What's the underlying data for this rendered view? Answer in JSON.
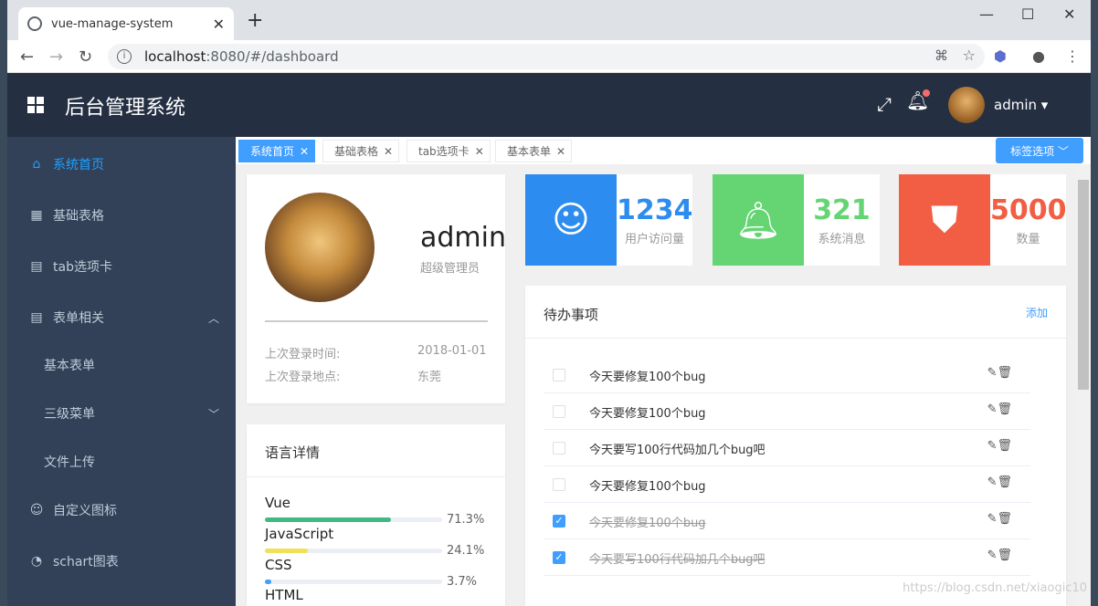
{
  "browser": {
    "tab_title": "vue-manage-system",
    "url_host": "localhost",
    "url_path": ":8080/#/dashboard"
  },
  "app": {
    "title": "后台管理系统",
    "username": "admin"
  },
  "sidebar": {
    "items": [
      {
        "label": "系统首页",
        "icon": "home-icon"
      },
      {
        "label": "基础表格",
        "icon": "grid-icon"
      },
      {
        "label": "tab选项卡",
        "icon": "copy-icon"
      },
      {
        "label": "表单相关",
        "icon": "calendar-icon"
      },
      {
        "label": "基本表单",
        "icon": ""
      },
      {
        "label": "三级菜单",
        "icon": ""
      },
      {
        "label": "文件上传",
        "icon": ""
      },
      {
        "label": "自定义图标",
        "icon": "smile-icon"
      },
      {
        "label": "schart图表",
        "icon": "pie-icon"
      }
    ]
  },
  "tags": {
    "items": [
      "系统首页",
      "基础表格",
      "tab选项卡",
      "基本表单"
    ],
    "options_label": "标签选项"
  },
  "profile": {
    "name": "admin",
    "role": "超级管理员",
    "last_login_time_label": "上次登录时间:",
    "last_login_time": "2018-01-01",
    "last_login_place_label": "上次登录地点:",
    "last_login_place": "东莞"
  },
  "languages": {
    "title": "语言详情",
    "items": [
      {
        "name": "Vue",
        "percent": 71.3,
        "text": "71.3%",
        "color": "#42b983"
      },
      {
        "name": "JavaScript",
        "percent": 24.1,
        "text": "24.1%",
        "color": "#f1e05a"
      },
      {
        "name": "CSS",
        "percent": 3.7,
        "text": "3.7%",
        "color": "#409eff"
      },
      {
        "name": "HTML",
        "percent": 0.9,
        "text": "",
        "color": "#f56c6c"
      }
    ]
  },
  "stats": [
    {
      "value": "1234",
      "label": "用户访问量",
      "color": "#2d8cf0"
    },
    {
      "value": "321",
      "label": "系统消息",
      "color": "#64d572"
    },
    {
      "value": "5000",
      "label": "数量",
      "color": "#f25e43"
    }
  ],
  "todo": {
    "title": "待办事项",
    "add_label": "添加",
    "items": [
      {
        "text": "今天要修复100个bug",
        "done": false
      },
      {
        "text": "今天要修复100个bug",
        "done": false
      },
      {
        "text": "今天要写100行代码加几个bug吧",
        "done": false
      },
      {
        "text": "今天要修复100个bug",
        "done": false
      },
      {
        "text": "今天要修复100个bug",
        "done": true
      },
      {
        "text": "今天要写100行代码加几个bug吧",
        "done": true
      }
    ]
  },
  "watermark": "https://blog.csdn.net/xiaogic10"
}
